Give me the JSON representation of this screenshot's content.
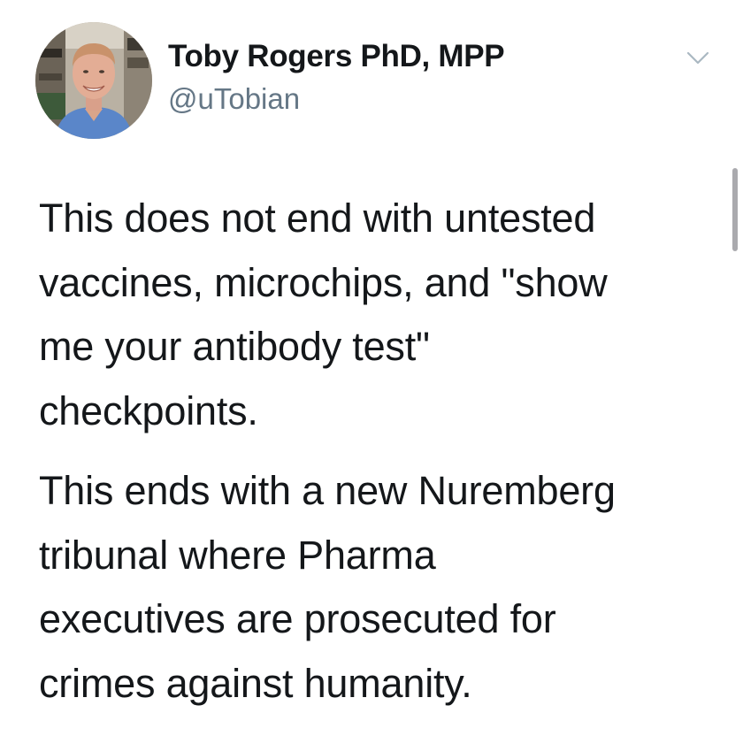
{
  "tweet": {
    "display_name": "Toby Rogers PhD, MPP",
    "handle": "@uTobian",
    "menu_icon": "chevron-down-icon",
    "paragraphs": [
      {
        "lines": [
          "This does not end with untested",
          "vaccines, microchips, and \"show",
          "me your antibody test\"",
          "checkpoints."
        ]
      },
      {
        "lines": [
          "This ends with a new Nuremberg",
          "tribunal where Pharma",
          "executives are prosecuted for",
          "crimes against humanity."
        ]
      }
    ]
  },
  "colors": {
    "text": "#14171a",
    "handle": "#657786",
    "caret": "#aab8c2",
    "background": "#ffffff"
  }
}
